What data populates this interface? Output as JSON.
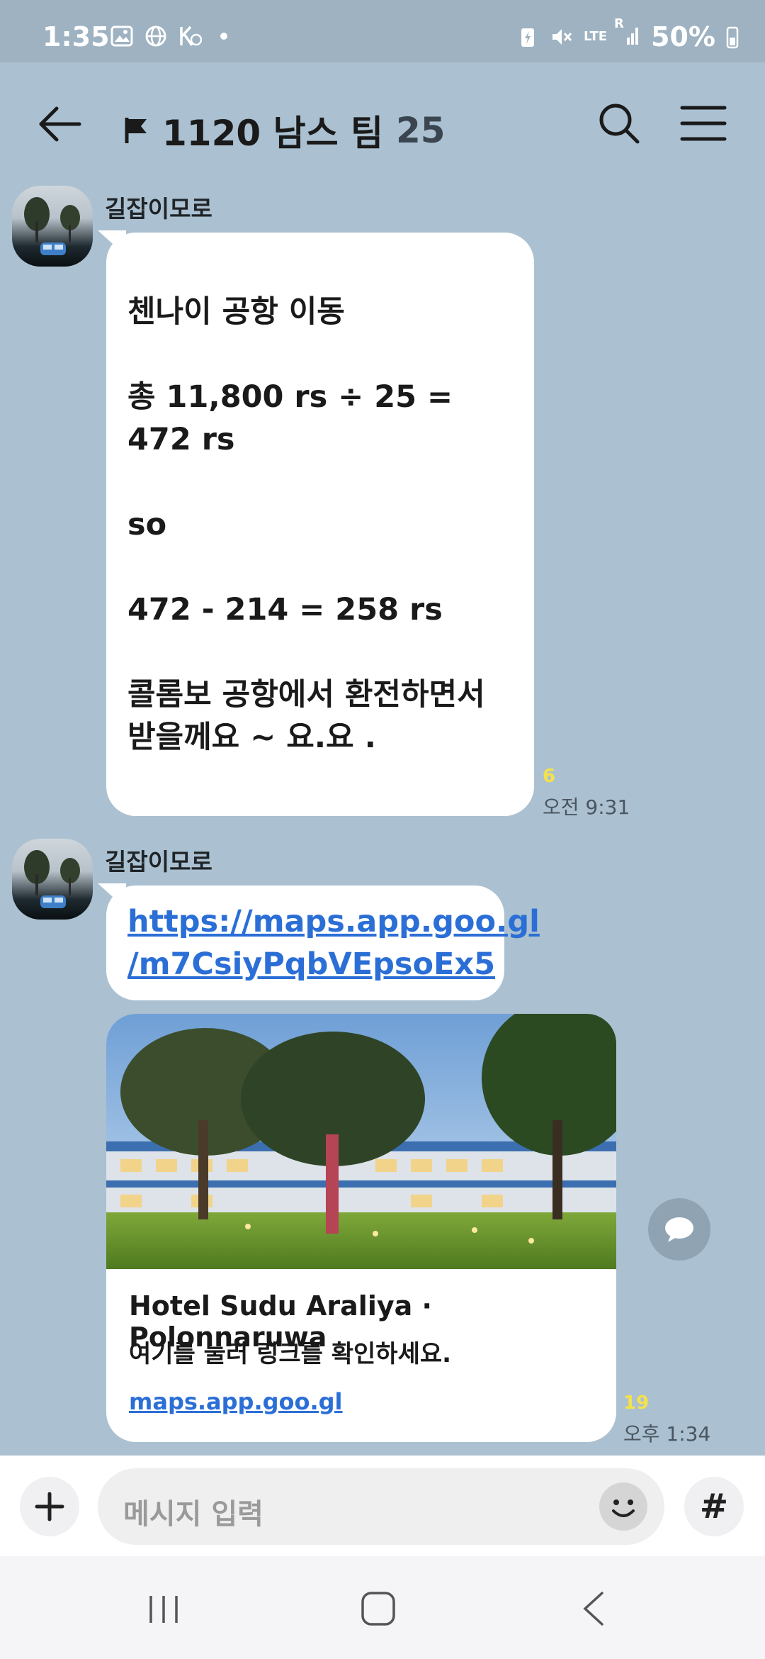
{
  "status_bar": {
    "time": "1:35",
    "battery": "50%",
    "network": "LTE",
    "network_r": "R"
  },
  "header": {
    "title": "1120  남스 팀",
    "member_count": "25"
  },
  "messages": [
    {
      "sender": "길잡이모로",
      "text": "첸나이 공항 이동\n\n총 11,800 rs  ÷ 25 = 472 rs\n\nso\n\n472 - 214  =  258 rs\n\n콜롬보 공항에서 환전하면서\n받을께요 ~ 요.요 .",
      "unread": "6",
      "time": "오전 9:31"
    },
    {
      "sender": "길잡이모로",
      "link_text": "https://maps.app.goo.gl\n/m7CsiyPqbVEpsoEx5",
      "card": {
        "title": "Hotel Sudu Araliya · Polonnaruwa",
        "subtitle": "여기를 눌러 링크를 확인하세요.",
        "domain": "maps.app.goo.gl"
      },
      "unread": "19",
      "time": "오후 1:34"
    }
  ],
  "input": {
    "placeholder": "메시지 입력",
    "hash_label": "#"
  },
  "colors": {
    "background": "#abc1d1",
    "bubble": "#ffffff",
    "link": "#2b6fd6",
    "unread": "#f5e24a"
  }
}
